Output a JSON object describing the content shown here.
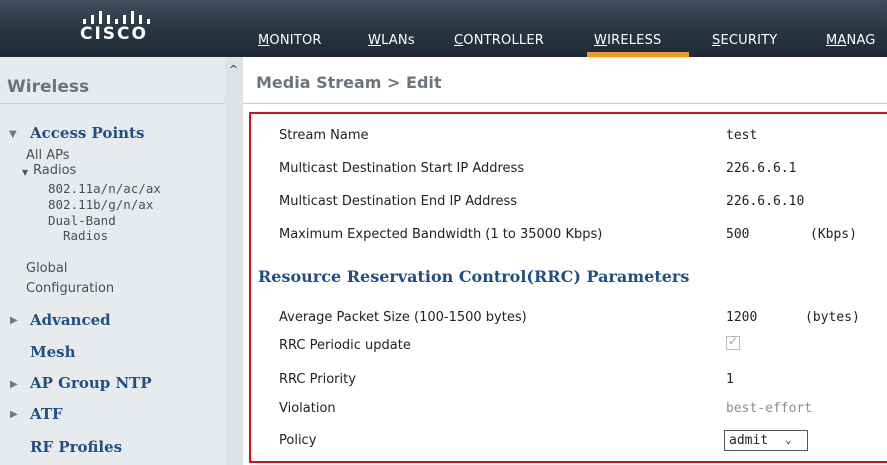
{
  "brand": {
    "logo_text": "CISCO"
  },
  "nav": {
    "items": [
      {
        "first": "M",
        "rest": "ONITOR"
      },
      {
        "first": "W",
        "rest": "LANs"
      },
      {
        "first": "C",
        "rest": "ONTROLLER"
      },
      {
        "first": "W",
        "rest": "IRELESS"
      },
      {
        "first": "S",
        "rest": "ECURITY"
      },
      {
        "first": "MA",
        "rest": "NAG"
      }
    ],
    "active": "WIRELESS",
    "accent_color": "#f29a1f"
  },
  "sidebar": {
    "title": "Wireless",
    "collapse_icon": "chevron-up-icon",
    "access_points": {
      "label": "Access Points",
      "all_aps": "All APs",
      "radios": "Radios",
      "radio_items": [
        "802.11a/n/ac/ax",
        "802.11b/g/n/ax",
        "Dual-Band",
        "Radios"
      ],
      "global_line1": "Global",
      "global_line2": "Configuration"
    },
    "sections": [
      "Advanced",
      "Mesh",
      "AP Group NTP",
      "ATF",
      "RF Profiles"
    ]
  },
  "main": {
    "title": "Media Stream > Edit",
    "fields": {
      "stream_name": {
        "label": "Stream Name",
        "value": "test"
      },
      "start_ip": {
        "label": "Multicast Destination Start IP Address",
        "value": "226.6.6.1"
      },
      "end_ip": {
        "label": "Multicast Destination End IP Address",
        "value": "226.6.6.10"
      },
      "bandwidth": {
        "label": "Maximum Expected Bandwidth (1 to 35000 Kbps)",
        "value": "500",
        "unit": "(Kbps)"
      }
    },
    "rrc": {
      "heading": "Resource Reservation Control(RRC) Parameters",
      "packet_size": {
        "label": "Average Packet Size (100-1500 bytes)",
        "value": "1200",
        "unit": "(bytes)"
      },
      "periodic_update": {
        "label": "RRC Periodic update",
        "checked": true
      },
      "priority": {
        "label": "RRC Priority",
        "value": "1"
      },
      "violation": {
        "label": "Violation",
        "value": "best-effort"
      },
      "policy": {
        "label": "Policy",
        "value": "admit"
      }
    },
    "highlight_color": "#d0121b"
  }
}
